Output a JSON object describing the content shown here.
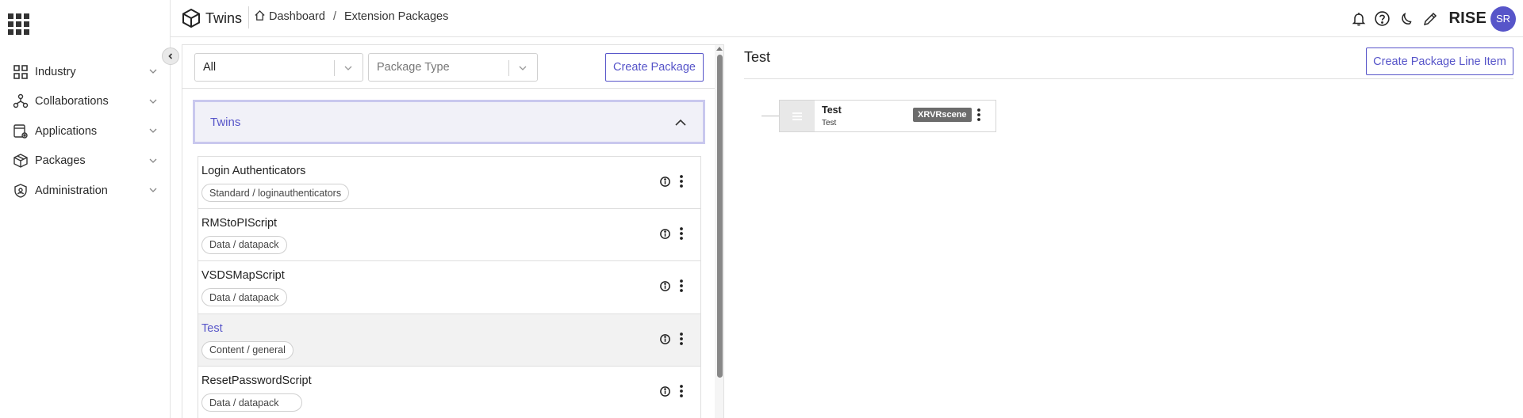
{
  "header": {
    "brand": "Twins",
    "breadcrumb": {
      "home": "Dashboard",
      "separator": "/",
      "current": "Extension Packages"
    },
    "org": "RISE",
    "avatar_initials": "SR"
  },
  "sidebar": {
    "items": [
      {
        "label": "Industry",
        "icon": "grid-icon"
      },
      {
        "label": "Collaborations",
        "icon": "network-icon"
      },
      {
        "label": "Applications",
        "icon": "apps-gear-icon"
      },
      {
        "label": "Packages",
        "icon": "box-icon"
      },
      {
        "label": "Administration",
        "icon": "shield-icon"
      }
    ]
  },
  "toolbar": {
    "filter_value": "All",
    "type_placeholder": "Package Type",
    "create_label": "Create Package"
  },
  "accordion": {
    "title": "Twins",
    "expanded": true
  },
  "packages": [
    {
      "name": "Login Authenticators",
      "tag": "Standard / loginauthenticators",
      "selected": false
    },
    {
      "name": "RMStoPIScript",
      "tag": "Data / datapack",
      "selected": false
    },
    {
      "name": "VSDSMapScript",
      "tag": "Data / datapack",
      "selected": false
    },
    {
      "name": "Test",
      "tag": "Content / general",
      "selected": true
    },
    {
      "name": "ResetPasswordScript",
      "tag": "Data / datapack",
      "selected": false
    }
  ],
  "detail": {
    "title": "Test",
    "create_line_label": "Create Package Line Item",
    "node": {
      "title": "Test",
      "subtitle": "Test",
      "badge": "XRVRscene"
    }
  },
  "colors": {
    "accent": "#5755c9",
    "selected_bg": "#f2f2f2",
    "badge_bg": "#6c6c6c"
  }
}
